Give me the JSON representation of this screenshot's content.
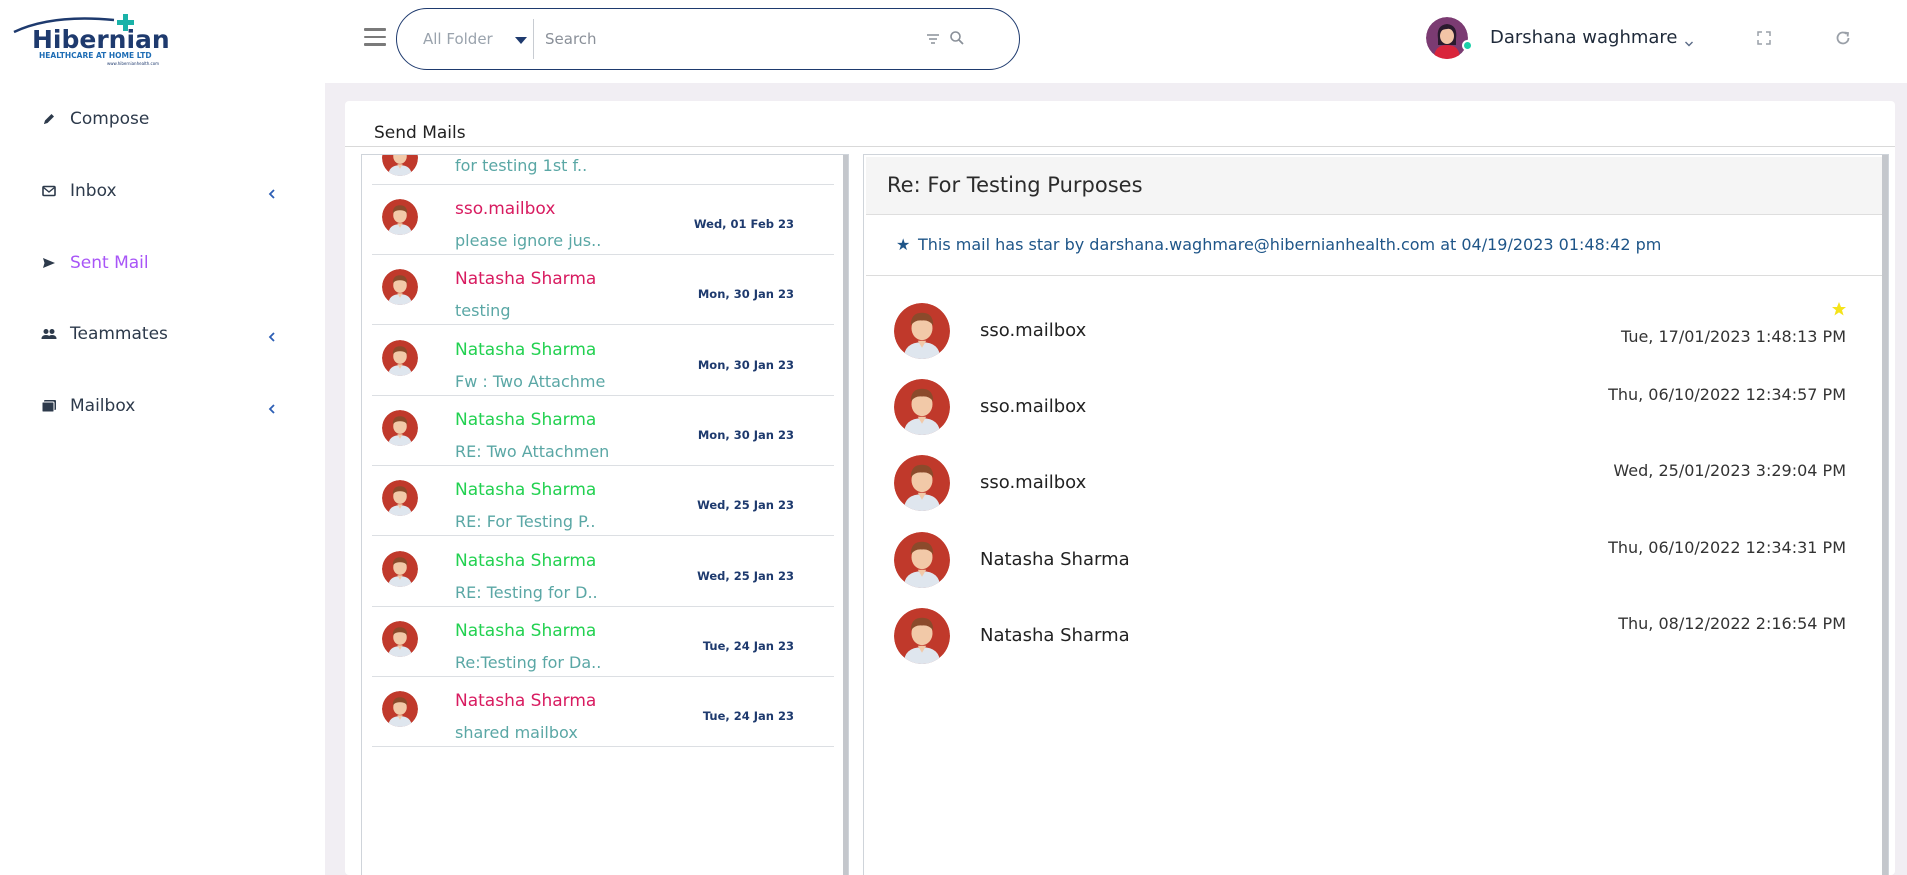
{
  "brand": {
    "logo_name": "Hibernian",
    "logo_tagline": "HEALTHCARE AT HOME LTD",
    "logo_url": "www.hibernianhealth.com",
    "accent": "#1e3a6e",
    "cross_color": "#1ab2a8"
  },
  "sidebar": {
    "items": [
      {
        "label": "Compose",
        "icon": "pencil-icon",
        "active": false,
        "has_chevron": false
      },
      {
        "label": "Inbox",
        "icon": "envelope-icon",
        "active": false,
        "has_chevron": true
      },
      {
        "label": "Sent Mail",
        "icon": "send-icon",
        "active": true,
        "has_chevron": false
      },
      {
        "label": "Teammates",
        "icon": "people-icon",
        "active": false,
        "has_chevron": true
      },
      {
        "label": "Mailbox",
        "icon": "folders-icon",
        "active": false,
        "has_chevron": true
      }
    ]
  },
  "header": {
    "folder_select": "All Folder",
    "search_placeholder": "Search",
    "user_name": "Darshana waghmare",
    "online_color": "#1bd0a8"
  },
  "main": {
    "title": "Send Mails"
  },
  "mail_list": {
    "partial_top": {
      "subject": "for testing 1st f.."
    },
    "rows": [
      {
        "sender": "sso.mailbox",
        "sender_color": "pink",
        "subject": "please ignore jus..",
        "date": "Wed, 01 Feb 23"
      },
      {
        "sender": "Natasha Sharma",
        "sender_color": "pink",
        "subject": "testing",
        "date": "Mon, 30 Jan 23"
      },
      {
        "sender": "Natasha Sharma",
        "sender_color": "green",
        "subject": "Fw : Two Attachme",
        "date": "Mon, 30 Jan 23"
      },
      {
        "sender": "Natasha Sharma",
        "sender_color": "green",
        "subject": "RE: Two Attachmen",
        "date": "Mon, 30 Jan 23"
      },
      {
        "sender": "Natasha Sharma",
        "sender_color": "green",
        "subject": "RE: For Testing P..",
        "date": "Wed, 25 Jan 23"
      },
      {
        "sender": "Natasha Sharma",
        "sender_color": "green",
        "subject": "RE: Testing for D..",
        "date": "Wed, 25 Jan 23"
      },
      {
        "sender": "Natasha Sharma",
        "sender_color": "green",
        "subject": "Re:Testing for Da..",
        "date": "Tue, 24 Jan 23"
      },
      {
        "sender": "Natasha Sharma",
        "sender_color": "pink",
        "subject": "shared mailbox",
        "date": "Tue, 24 Jan 23"
      }
    ]
  },
  "reading_pane": {
    "subject": "Re: For Testing Purposes",
    "star_note": "This mail has star by darshana.waghmare@hibernianhealth.com at 04/19/2023 01:48:42 pm",
    "thread": [
      {
        "sender": "sso.mailbox",
        "date": "Tue, 17/01/2023 1:48:13 PM",
        "starred": true
      },
      {
        "sender": "sso.mailbox",
        "date": "Thu, 06/10/2022 12:34:57 PM",
        "starred": false
      },
      {
        "sender": "sso.mailbox",
        "date": "Wed, 25/01/2023 3:29:04 PM",
        "starred": false
      },
      {
        "sender": "Natasha Sharma",
        "date": "Thu, 06/10/2022 12:34:31 PM",
        "starred": false
      },
      {
        "sender": "Natasha Sharma",
        "date": "Thu, 08/12/2022 2:16:54 PM",
        "starred": false
      }
    ]
  }
}
